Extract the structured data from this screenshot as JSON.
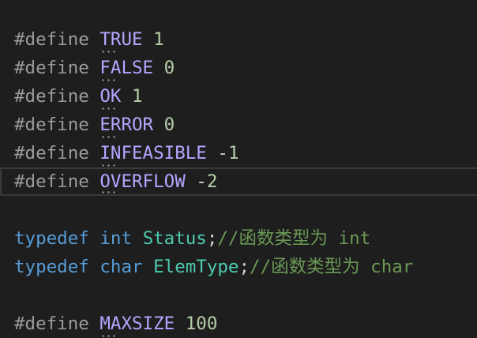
{
  "editor": {
    "lines": [
      {
        "pp": "#define",
        "name": "TRUE",
        "value": "1"
      },
      {
        "pp": "#define",
        "name": "FALSE",
        "value": "0"
      },
      {
        "pp": "#define",
        "name": "OK",
        "value": "1"
      },
      {
        "pp": "#define",
        "name": "ERROR",
        "value": "0"
      },
      {
        "pp": "#define",
        "name": "INFEASIBLE",
        "op": "-",
        "value": "1"
      },
      {
        "pp": "#define",
        "name": "OVERFLOW",
        "op": "-",
        "value": "2"
      }
    ],
    "typedefs": [
      {
        "kw": "typedef",
        "base": "int",
        "name": "Status",
        "semi": ";",
        "comment": "//函数类型为 int"
      },
      {
        "kw": "typedef",
        "base": "char",
        "name": "ElemType",
        "semi": ";",
        "comment": "//函数类型为 char"
      }
    ],
    "maxsize": {
      "pp": "#define",
      "name": "MAXSIZE",
      "value": "100"
    }
  },
  "colors": {
    "background": "#1e1e1e",
    "preprocessor": "#9b9b9b",
    "macro": "#b5a5ff",
    "number": "#b5cea8",
    "keyword": "#569cd6",
    "type": "#4ec9b0",
    "comment": "#6a9955",
    "current_line_border": "#3a3a3a"
  }
}
